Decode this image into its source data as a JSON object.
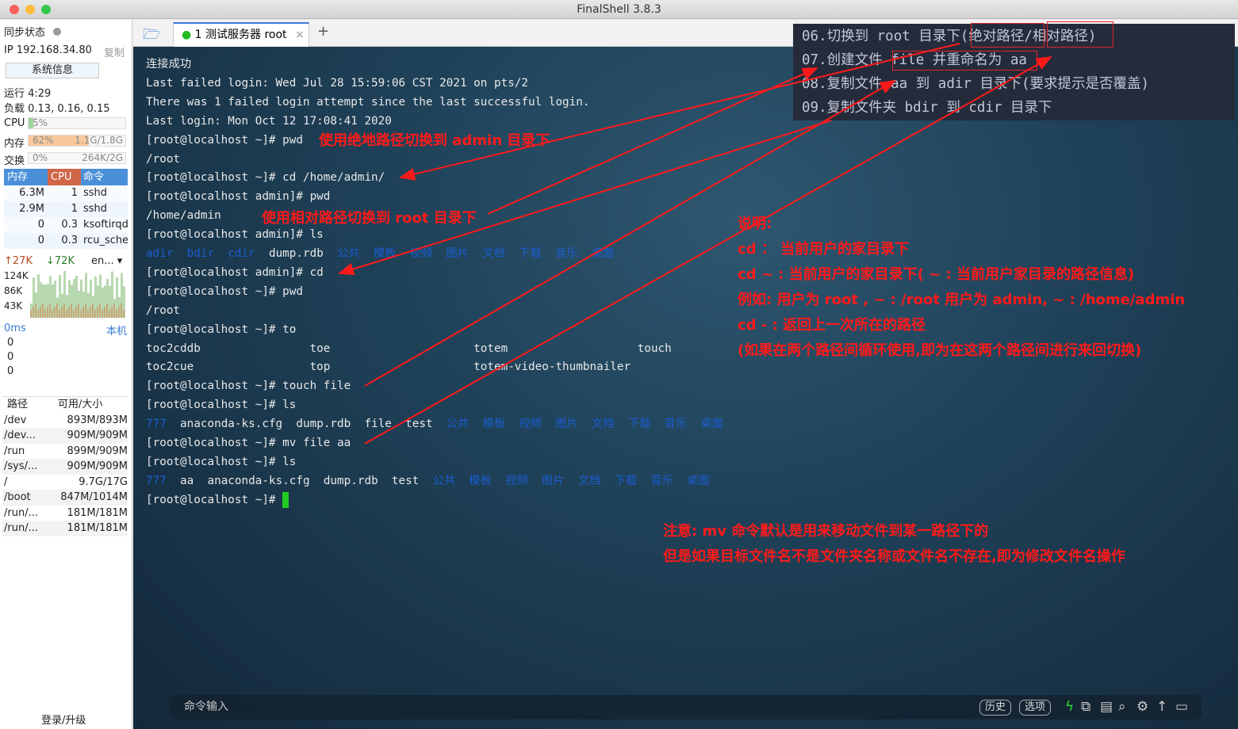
{
  "window": {
    "title": "FinalShell 3.8.3"
  },
  "sidebar": {
    "sync_label": "同步状态",
    "ip": "IP 192.168.34.80",
    "copy": "复制",
    "sysinfo_button": "系统信息",
    "uptime": "运行 4:29",
    "load": "负载 0.13, 0.16, 0.15",
    "cpu": {
      "label": "CPU",
      "text": "5%",
      "percent": 5
    },
    "mem": {
      "label": "内存",
      "text": "62%",
      "detail": "1.1G/1.8G",
      "percent": 62
    },
    "swap": {
      "label": "交换",
      "text": "0%",
      "detail": "264K/2G",
      "percent": 0
    },
    "proc_headers": [
      "内存",
      "CPU",
      "命令"
    ],
    "processes": [
      [
        "6.3M",
        "1",
        "sshd"
      ],
      [
        "2.9M",
        "1",
        "sshd"
      ],
      [
        "0",
        "0.3",
        "ksoftirqd/"
      ],
      [
        "0",
        "0.3",
        "rcu_sched"
      ]
    ],
    "net": {
      "up": "27K",
      "down": "72K",
      "iface": "en...",
      "ticks": [
        "124K",
        "86K",
        "43K"
      ]
    },
    "ping": {
      "label": "0ms",
      "host": "本机",
      "values": [
        "0",
        "0",
        "0"
      ]
    },
    "disk_headers": [
      "路径",
      "可用/大小"
    ],
    "disks": [
      [
        "/dev",
        "893M/893M"
      ],
      [
        "/dev...",
        "909M/909M"
      ],
      [
        "/run",
        "899M/909M"
      ],
      [
        "/sys/...",
        "909M/909M"
      ],
      [
        "/",
        "9.7G/17G"
      ],
      [
        "/boot",
        "847M/1014M"
      ],
      [
        "/run/...",
        "181M/181M"
      ],
      [
        "/run/...",
        "181M/181M"
      ]
    ],
    "login": "登录/升级"
  },
  "tabs": [
    {
      "label": "1 测试服务器 root",
      "active": true
    }
  ],
  "terminal": {
    "lines": [
      "连接成功",
      "Last failed login: Wed Jul 28 15:59:06 CST 2021 on pts/2",
      "There was 1 failed login attempt since the last successful login.",
      "Last login: Mon Oct 12 17:08:41 2020",
      "[root@localhost ~]# pwd",
      "/root",
      "[root@localhost ~]# cd /home/admin/",
      "[root@localhost admin]# pwd",
      "/home/admin",
      "[root@localhost admin]# ls",
      "",
      "[root@localhost admin]# cd",
      "[root@localhost ~]# pwd",
      "/root",
      "[root@localhost ~]# to",
      "toc2cddb                toe                     totem                   touch",
      "toc2cue                 top                     totem-video-thumbnailer",
      "[root@localhost ~]# touch file",
      "[root@localhost ~]# ls",
      "",
      "[root@localhost ~]# mv file aa",
      "[root@localhost ~]# ls",
      "",
      "[root@localhost ~]# "
    ],
    "ls1": [
      [
        "adir",
        1
      ],
      [
        "bdir",
        1
      ],
      [
        "cdir",
        1
      ],
      [
        "dump.rdb",
        0
      ],
      [
        "公共",
        1
      ],
      [
        "模板",
        1
      ],
      [
        "视频",
        1
      ],
      [
        "图片",
        1
      ],
      [
        "文档",
        1
      ],
      [
        "下载",
        1
      ],
      [
        "音乐",
        1
      ],
      [
        "桌面",
        1
      ]
    ],
    "ls2": [
      [
        "777",
        1
      ],
      [
        "anaconda-ks.cfg",
        0
      ],
      [
        "dump.rdb",
        0
      ],
      [
        "file",
        0
      ],
      [
        "test",
        0
      ],
      [
        "公共",
        1
      ],
      [
        "模板",
        1
      ],
      [
        "视频",
        1
      ],
      [
        "图片",
        1
      ],
      [
        "文档",
        1
      ],
      [
        "下载",
        1
      ],
      [
        "音乐",
        1
      ],
      [
        "桌面",
        1
      ]
    ],
    "ls3": [
      [
        "777",
        1
      ],
      [
        "aa",
        0
      ],
      [
        "anaconda-ks.cfg",
        0
      ],
      [
        "dump.rdb",
        0
      ],
      [
        "test",
        0
      ],
      [
        "公共",
        1
      ],
      [
        "模板",
        1
      ],
      [
        "视频",
        1
      ],
      [
        "图片",
        1
      ],
      [
        "文档",
        1
      ],
      [
        "下载",
        1
      ],
      [
        "音乐",
        1
      ],
      [
        "桌面",
        1
      ]
    ]
  },
  "annotations": {
    "abs": "使用绝地路径切换到 admin 目录下",
    "rel": "使用相对路径切换到 root 目录下",
    "notes": [
      "说明:",
      "cd ： 当前用户的家目录下",
      "cd ~ : 当前用户的家目录下( ~ : 当前用户家目录的路径信息)",
      "例如: 用户为 root , ~ : /root 用户为 admin, ~ : /home/admin",
      "cd - : 返回上一次所在的路径",
      "(如果在两个路径间循环使用,即为在这两个路径间进行来回切换)"
    ],
    "mv": [
      "注意: mv 命令默认是用来移动文件到某一路径下的",
      "但是如果目标文件名不是文件夹名称或文件名不存在,即为修改文件名操作"
    ]
  },
  "tasks": [
    "06.切换到 root 目录下(绝对路径/相对路径)",
    "07.创建文件 file 并重命名为 aa",
    "08.复制文件 aa 到 adir 目录下(要求提示是否覆盖)",
    "09.复制文件夹 bdir 到 cdir 目录下"
  ],
  "cmdbar": {
    "placeholder": "命令输入",
    "history": "历史",
    "options": "选项"
  },
  "colors": {
    "accent": "#3a7bd5",
    "annotation": "#ff1a1a",
    "dir": "#1a5ccf",
    "cursor": "#22cc22"
  }
}
